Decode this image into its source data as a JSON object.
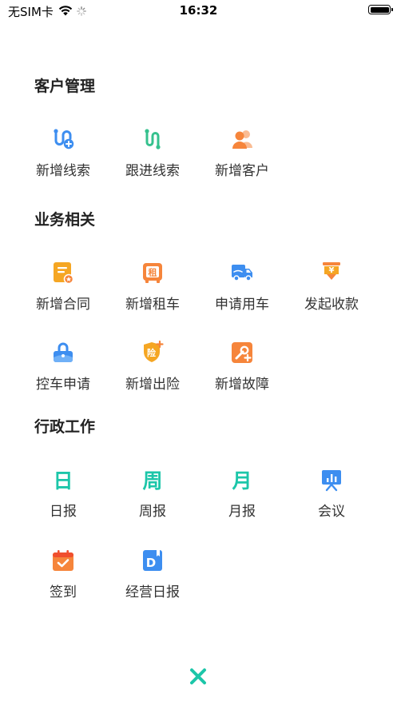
{
  "status_bar": {
    "carrier": "无SIM卡",
    "time": "16:32"
  },
  "colors": {
    "teal": "#1CC6A9",
    "blue": "#3D8EF0",
    "green": "#35C18E",
    "orange": "#F6853B",
    "amber": "#F5A623"
  },
  "sections": [
    {
      "title": "客户管理",
      "items": [
        {
          "label": "新增线索",
          "icon": "new-lead-icon"
        },
        {
          "label": "跟进线索",
          "icon": "follow-lead-icon"
        },
        {
          "label": "新增客户",
          "icon": "new-customer-icon"
        }
      ]
    },
    {
      "title": "业务相关",
      "items": [
        {
          "label": "新增合同",
          "icon": "new-contract-icon"
        },
        {
          "label": "新增租车",
          "icon": "new-rental-icon",
          "glyph": "租"
        },
        {
          "label": "申请用车",
          "icon": "apply-vehicle-icon"
        },
        {
          "label": "发起收款",
          "icon": "collect-payment-icon",
          "glyph": "¥"
        },
        {
          "label": "控车申请",
          "icon": "vehicle-control-icon"
        },
        {
          "label": "新增出险",
          "icon": "new-insurance-claim-icon",
          "glyph": "险"
        },
        {
          "label": "新增故障",
          "icon": "new-fault-icon"
        }
      ]
    },
    {
      "title": "行政工作",
      "items": [
        {
          "label": "日报",
          "icon": "daily-report-icon",
          "glyph": "日"
        },
        {
          "label": "周报",
          "icon": "weekly-report-icon",
          "glyph": "周"
        },
        {
          "label": "月报",
          "icon": "monthly-report-icon",
          "glyph": "月"
        },
        {
          "label": "会议",
          "icon": "meeting-icon"
        },
        {
          "label": "签到",
          "icon": "check-in-icon"
        },
        {
          "label": "经营日报",
          "icon": "business-daily-icon",
          "glyph": "D"
        }
      ]
    }
  ],
  "close": {
    "icon": "close-icon"
  }
}
